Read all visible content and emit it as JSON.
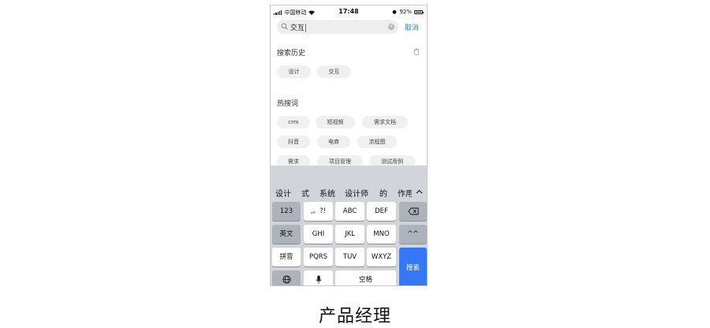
{
  "status": {
    "carrier": "中国移动",
    "time": "17:48",
    "battery": "92%"
  },
  "search": {
    "value": "交互",
    "cancel": "取消"
  },
  "history": {
    "title": "搜索历史",
    "tags": [
      "设计",
      "交互"
    ]
  },
  "hot": {
    "title": "热搜词",
    "rows": [
      [
        "crm",
        "短视频",
        "需求文档"
      ],
      [
        "抖音",
        "电商",
        "流程图"
      ],
      [
        "需求",
        "项目管理",
        "测试用例"
      ]
    ]
  },
  "candidates": [
    "设计",
    "式",
    "系统",
    "设计师",
    "的",
    "作用"
  ],
  "keyboard": {
    "num": "123",
    "punct": ",。?!",
    "abc": "ABC",
    "def": "DEF",
    "en": "英文",
    "ghi": "GHI",
    "jkl": "JKL",
    "mno": "MNO",
    "emoji": "^^",
    "pinyin": "拼音",
    "pqrs": "PQRS",
    "tuv": "TUV",
    "wxyz": "WXYZ",
    "space": "空格",
    "search": "搜索"
  },
  "caption": "产品经理",
  "colors": {
    "accent": "#3478f6",
    "link": "#3b82e0",
    "chip_bg": "#f0f0f0",
    "keyboard_bg": "#d1d4d9"
  }
}
